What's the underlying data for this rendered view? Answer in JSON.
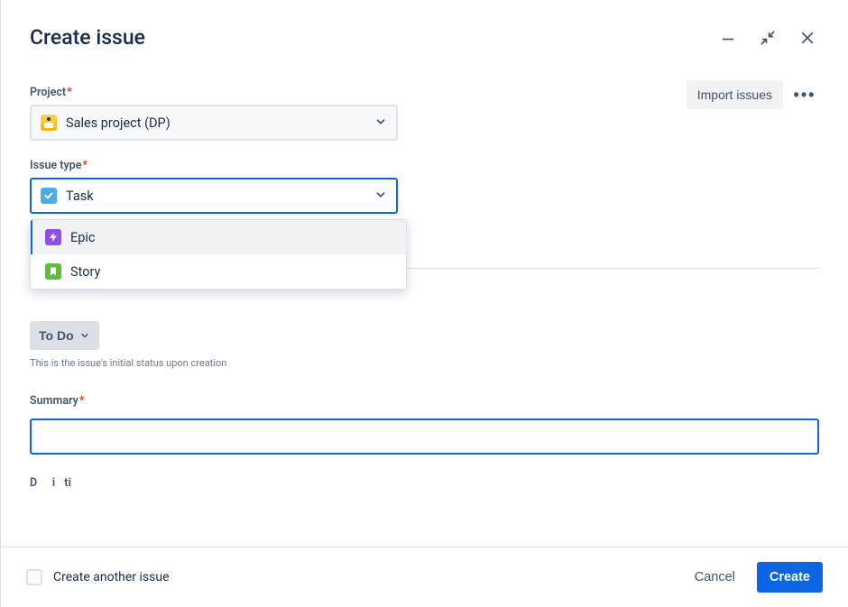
{
  "header": {
    "title": "Create issue"
  },
  "actions": {
    "import_label": "Import issues",
    "cancel_label": "Cancel",
    "create_label": "Create",
    "create_another_label": "Create another issue"
  },
  "fields": {
    "project": {
      "label": "Project",
      "value": "Sales project (DP)"
    },
    "issue_type": {
      "label": "Issue type",
      "value": "Task",
      "options": [
        {
          "label": "Epic",
          "icon": "epic"
        },
        {
          "label": "Story",
          "icon": "story"
        }
      ]
    },
    "status": {
      "value": "To Do",
      "hint": "This is the issue's initial status upon creation"
    },
    "summary": {
      "label": "Summary",
      "value": ""
    }
  },
  "colors": {
    "primary": "#0C66E4",
    "danger": "#DE350B"
  }
}
